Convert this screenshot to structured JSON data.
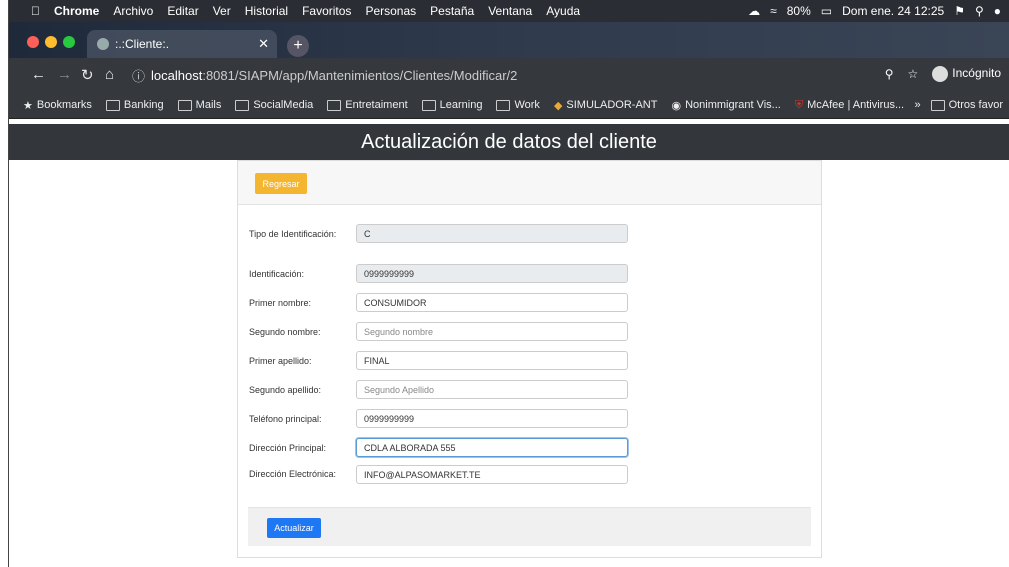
{
  "menubar": {
    "apple": "",
    "items": [
      "Chrome",
      "Archivo",
      "Editar",
      "Ver",
      "Historial",
      "Favoritos",
      "Personas",
      "Pestaña",
      "Ventana",
      "Ayuda"
    ],
    "battery": "80%",
    "clock": "Dom ene. 24  12:25"
  },
  "browser": {
    "tab_title": ":.:Cliente:.",
    "url_host": "localhost",
    "url_rest": ":8081/SIAPM/app/Mantenimientos/Clientes/Modificar/2",
    "incognito_label": "Incógnito"
  },
  "bookmarks": {
    "items": [
      "Bookmarks",
      "Banking",
      "Mails",
      "SocialMedia",
      "Entretaiment",
      "Learning",
      "Work",
      "SIMULADOR-ANT",
      "Nonimmigrant Vis...",
      "McAfee | Antivirus..."
    ],
    "more": "»",
    "other": "Otros favor"
  },
  "page": {
    "title": "Actualización de datos del cliente",
    "back_button": "Regresar",
    "update_button": "Actualizar"
  },
  "form": {
    "fields": [
      {
        "label": "Tipo de Identificación:",
        "value": "C",
        "state": "disabled"
      },
      {
        "label": "Identificación:",
        "value": "0999999999",
        "state": "disabled"
      },
      {
        "label": "Primer nombre:",
        "value": "CONSUMIDOR",
        "state": "normal"
      },
      {
        "label": "Segundo nombre:",
        "placeholder": "Segundo nombre",
        "state": "placeholder"
      },
      {
        "label": "Primer apellido:",
        "value": "FINAL",
        "state": "normal"
      },
      {
        "label": "Segundo apellido:",
        "placeholder": "Segundo Apellido",
        "state": "placeholder"
      },
      {
        "label": "Teléfono principal:",
        "value": "0999999999",
        "state": "normal"
      },
      {
        "label": "Dirección Principal:",
        "value": "CDLA ALBORADA 555",
        "state": "focus"
      },
      {
        "label": "Dirección Electrónica:",
        "value": "INFO@ALPASOMARKET.TE",
        "state": "normal"
      }
    ]
  },
  "colors": {
    "header_bg": "#33373c",
    "back_button": "#f4b531",
    "update_button": "#1e77f3"
  }
}
